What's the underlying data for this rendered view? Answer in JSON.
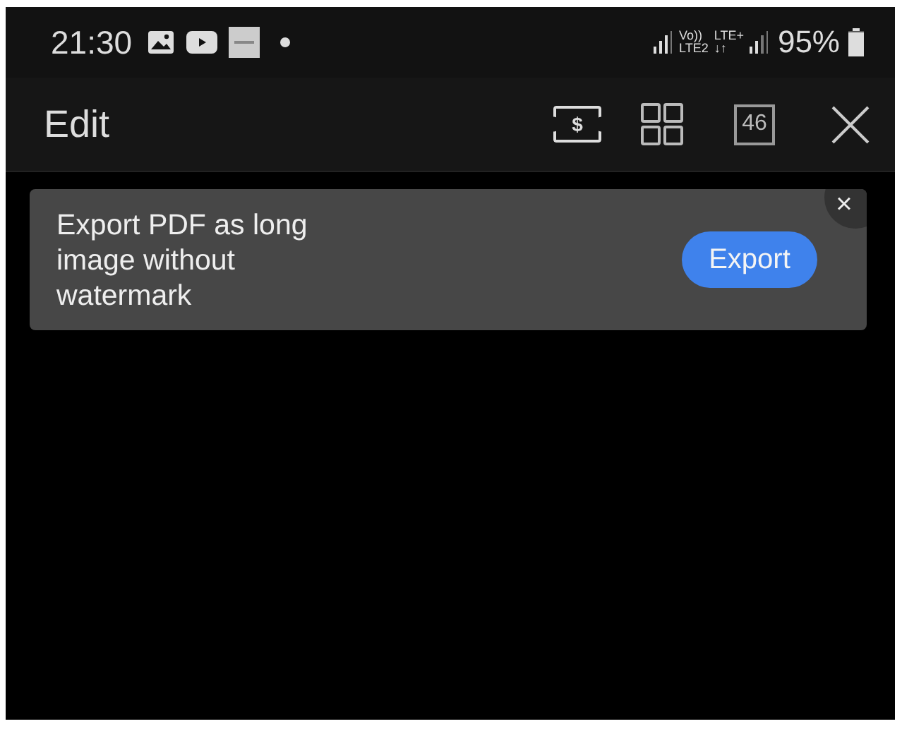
{
  "status_bar": {
    "time": "21:30",
    "network_labels": [
      "Vo))",
      "LTE2",
      "LTE+",
      "↓↑"
    ],
    "battery_percent": "95%",
    "battery": {
      "level": 0.95
    }
  },
  "toolbar": {
    "title": "Edit",
    "ticket_symbol": "$",
    "page_count": "46"
  },
  "banner": {
    "message": "Export PDF as long image without watermark",
    "button": "Export",
    "close": "×"
  }
}
